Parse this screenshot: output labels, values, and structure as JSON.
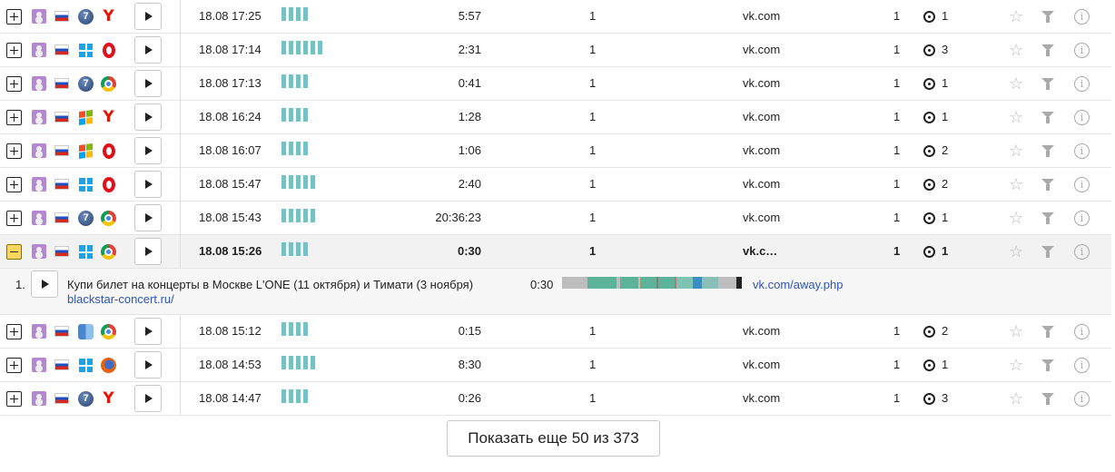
{
  "rows": [
    {
      "os": "win7",
      "browser": "yandex",
      "date": "18.08 17:25",
      "activity": 4,
      "duration": "5:57",
      "views": "1",
      "source": "vk.com",
      "count": "1",
      "goals": "1",
      "expanded": false
    },
    {
      "os": "win10",
      "browser": "opera",
      "date": "18.08 17:14",
      "activity": 6,
      "duration": "2:31",
      "views": "1",
      "source": "vk.com",
      "count": "1",
      "goals": "3",
      "expanded": false
    },
    {
      "os": "win7",
      "browser": "chrome",
      "date": "18.08 17:13",
      "activity": 4,
      "duration": "0:41",
      "views": "1",
      "source": "vk.com",
      "count": "1",
      "goals": "1",
      "expanded": false
    },
    {
      "os": "winxp",
      "browser": "yandex",
      "date": "18.08 16:24",
      "activity": 4,
      "duration": "1:28",
      "views": "1",
      "source": "vk.com",
      "count": "1",
      "goals": "1",
      "expanded": false
    },
    {
      "os": "winxp",
      "browser": "opera",
      "date": "18.08 16:07",
      "activity": 4,
      "duration": "1:06",
      "views": "1",
      "source": "vk.com",
      "count": "1",
      "goals": "2",
      "expanded": false
    },
    {
      "os": "win10",
      "browser": "opera",
      "date": "18.08 15:47",
      "activity": 5,
      "duration": "2:40",
      "views": "1",
      "source": "vk.com",
      "count": "1",
      "goals": "2",
      "expanded": false
    },
    {
      "os": "win7",
      "browser": "chrome",
      "date": "18.08 15:43",
      "activity": 5,
      "duration": "20:36:23",
      "views": "1",
      "source": "vk.com",
      "count": "1",
      "goals": "1",
      "expanded": false
    },
    {
      "os": "win10",
      "browser": "chrome",
      "date": "18.08 15:26",
      "activity": 4,
      "duration": "0:30",
      "views": "1",
      "source": "vk.c…",
      "count": "1",
      "goals": "1",
      "expanded": true
    },
    {
      "os": "mac",
      "browser": "chrome",
      "date": "18.08 15:12",
      "activity": 4,
      "duration": "0:15",
      "views": "1",
      "source": "vk.com",
      "count": "1",
      "goals": "2",
      "expanded": false
    },
    {
      "os": "win10",
      "browser": "firefox",
      "date": "18.08 14:53",
      "activity": 5,
      "duration": "8:30",
      "views": "1",
      "source": "vk.com",
      "count": "1",
      "goals": "1",
      "expanded": false
    },
    {
      "os": "win7",
      "browser": "yandex",
      "date": "18.08 14:47",
      "activity": 4,
      "duration": "0:26",
      "views": "1",
      "source": "vk.com",
      "count": "1",
      "goals": "3",
      "expanded": false
    }
  ],
  "detail": {
    "number": "1.",
    "title": "Купи билет на концерты в Москве L'ONE (11 октября) и Тимати (3 ноября)",
    "url": "blackstar-concert.ru/",
    "time": "0:30",
    "referrer": "vk.com/away.php"
  },
  "icons": {
    "star": "☆",
    "info": "i",
    "win7_glyph": "7",
    "yandex_glyph": "Y"
  },
  "more_button": "Показать еще 50 из 373"
}
